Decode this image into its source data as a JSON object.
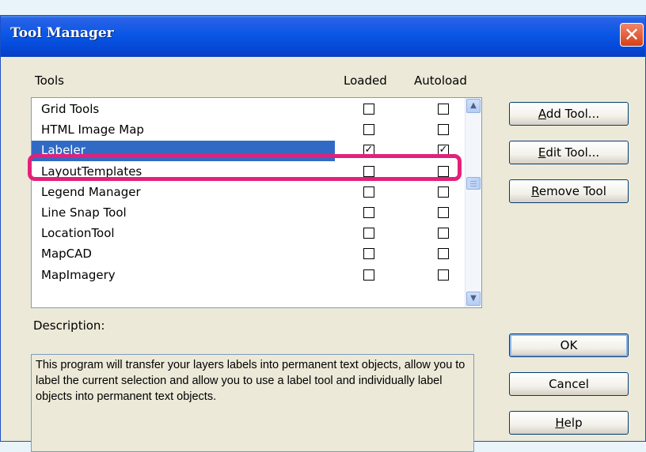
{
  "window": {
    "title": "Tool Manager",
    "close_symbol": "✕"
  },
  "columns": {
    "tools": "Tools",
    "loaded": "Loaded",
    "autoload": "Autoload"
  },
  "tools": [
    {
      "name": "Grid Tools",
      "loaded": false,
      "autoload": false,
      "selected": false
    },
    {
      "name": "HTML Image Map",
      "loaded": false,
      "autoload": false,
      "selected": false
    },
    {
      "name": "Labeler",
      "loaded": true,
      "autoload": true,
      "selected": true
    },
    {
      "name": "LayoutTemplates",
      "loaded": false,
      "autoload": false,
      "selected": false
    },
    {
      "name": "Legend Manager",
      "loaded": false,
      "autoload": false,
      "selected": false
    },
    {
      "name": "Line Snap Tool",
      "loaded": false,
      "autoload": false,
      "selected": false
    },
    {
      "name": "LocationTool",
      "loaded": false,
      "autoload": false,
      "selected": false
    },
    {
      "name": "MapCAD",
      "loaded": false,
      "autoload": false,
      "selected": false
    },
    {
      "name": "MapImagery",
      "loaded": false,
      "autoload": false,
      "selected": false
    }
  ],
  "scroll": {
    "up_arrow": "▲",
    "down_arrow": "▼"
  },
  "description": {
    "label": "Description:",
    "text": "This program will transfer your layers labels into permanent text objects, allow you to label the current selection and allow you to use a label tool and individually label objects into permanent text objects."
  },
  "buttons": {
    "add_tool": {
      "mnemonic": "A",
      "rest": "dd Tool..."
    },
    "edit_tool": {
      "mnemonic": "E",
      "rest": "dit Tool..."
    },
    "remove_tool": {
      "mnemonic": "R",
      "rest": "emove Tool"
    },
    "ok": "OK",
    "cancel": "Cancel",
    "help": {
      "mnemonic": "H",
      "rest": "elp"
    }
  },
  "colors": {
    "titlebar": "#0a57e6",
    "selection": "#316ac5",
    "annotation_highlight": "#e3217a",
    "dialog_bg": "#ece9d8"
  }
}
